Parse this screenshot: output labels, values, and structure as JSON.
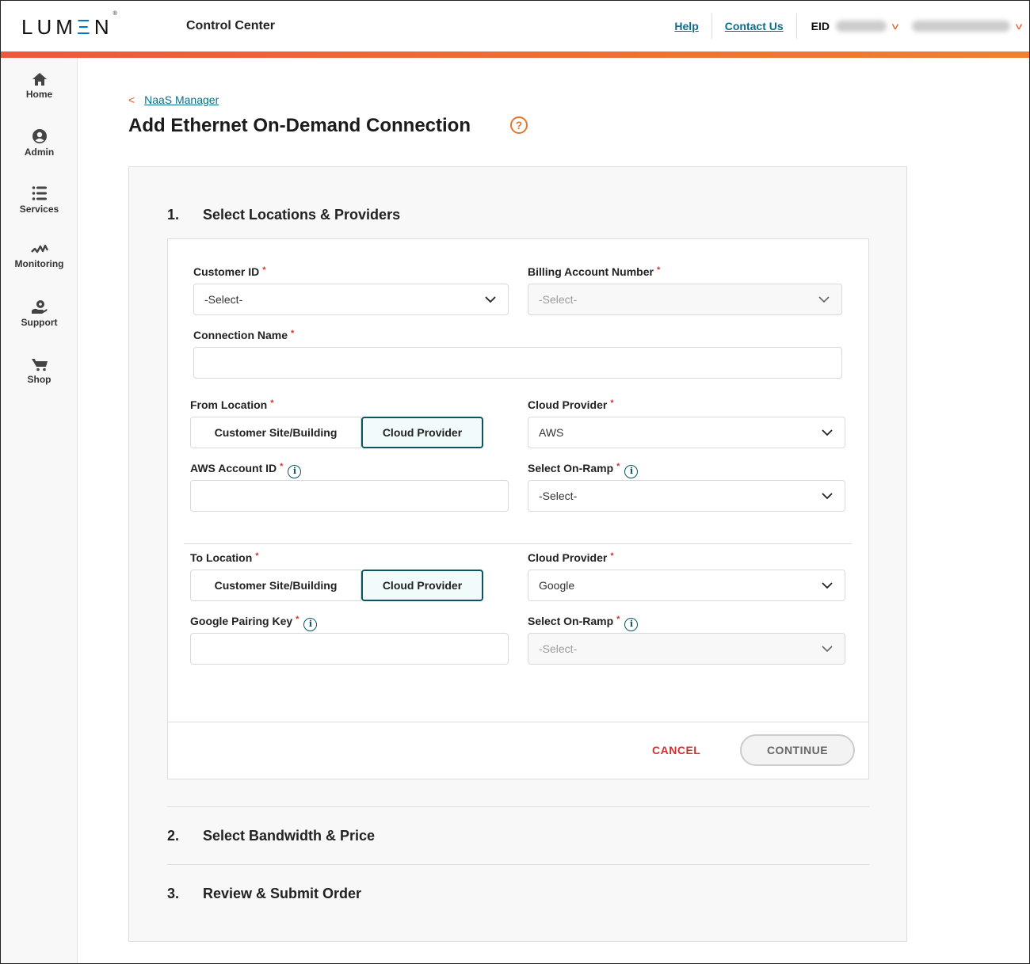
{
  "header": {
    "logo": "LUMEN",
    "app_title": "Control Center",
    "links": [
      "Help",
      "Contact Us"
    ],
    "eid_label": "EID",
    "eid_value": "[blurred]",
    "user_value": "[blurred]",
    "accent": "#f0563e"
  },
  "sidebar": {
    "items": [
      {
        "label": "Home",
        "icon": "home-icon"
      },
      {
        "label": "Admin",
        "icon": "user-circle-icon"
      },
      {
        "label": "Services",
        "icon": "list-icon"
      },
      {
        "label": "Monitoring",
        "icon": "pulse-icon"
      },
      {
        "label": "Support",
        "icon": "support-icon"
      },
      {
        "label": "Shop",
        "icon": "cart-icon"
      }
    ]
  },
  "breadcrumb": {
    "label": "NaaS Manager"
  },
  "page": {
    "title": "Add Ethernet On-Demand Connection",
    "help_icon": "?"
  },
  "wizard": {
    "steps": [
      {
        "num": "1.",
        "title": "Select Locations & Providers"
      },
      {
        "num": "2.",
        "title": "Select Bandwidth & Price"
      },
      {
        "num": "3.",
        "title": "Review & Submit Order"
      }
    ],
    "form": {
      "required_mark": "*",
      "customer_id": {
        "label": "Customer ID",
        "value": "-Select-"
      },
      "billing_account": {
        "label": "Billing Account Number",
        "value": "-Select-",
        "disabled": true
      },
      "connection_name": {
        "label": "Connection Name",
        "value": ""
      },
      "from_location": {
        "label": "From Location",
        "options": [
          "Customer Site/Building",
          "Cloud Provider"
        ],
        "selected": "Cloud Provider"
      },
      "from_cloud_provider": {
        "label": "Cloud Provider",
        "value": "AWS"
      },
      "aws_account_id": {
        "label": "AWS Account ID",
        "value": ""
      },
      "from_on_ramp": {
        "label": "Select On-Ramp",
        "value": "-Select-"
      },
      "to_location": {
        "label": "To Location",
        "options": [
          "Customer Site/Building",
          "Cloud Provider"
        ],
        "selected": "Cloud Provider"
      },
      "to_cloud_provider": {
        "label": "Cloud Provider",
        "value": "Google"
      },
      "google_pairing_key": {
        "label": "Google Pairing Key",
        "value": ""
      },
      "to_on_ramp": {
        "label": "Select On-Ramp",
        "value": "-Select-",
        "disabled": true
      },
      "info_glyph": "i"
    },
    "actions": {
      "cancel": "CANCEL",
      "continue": "CONTINUE"
    }
  }
}
